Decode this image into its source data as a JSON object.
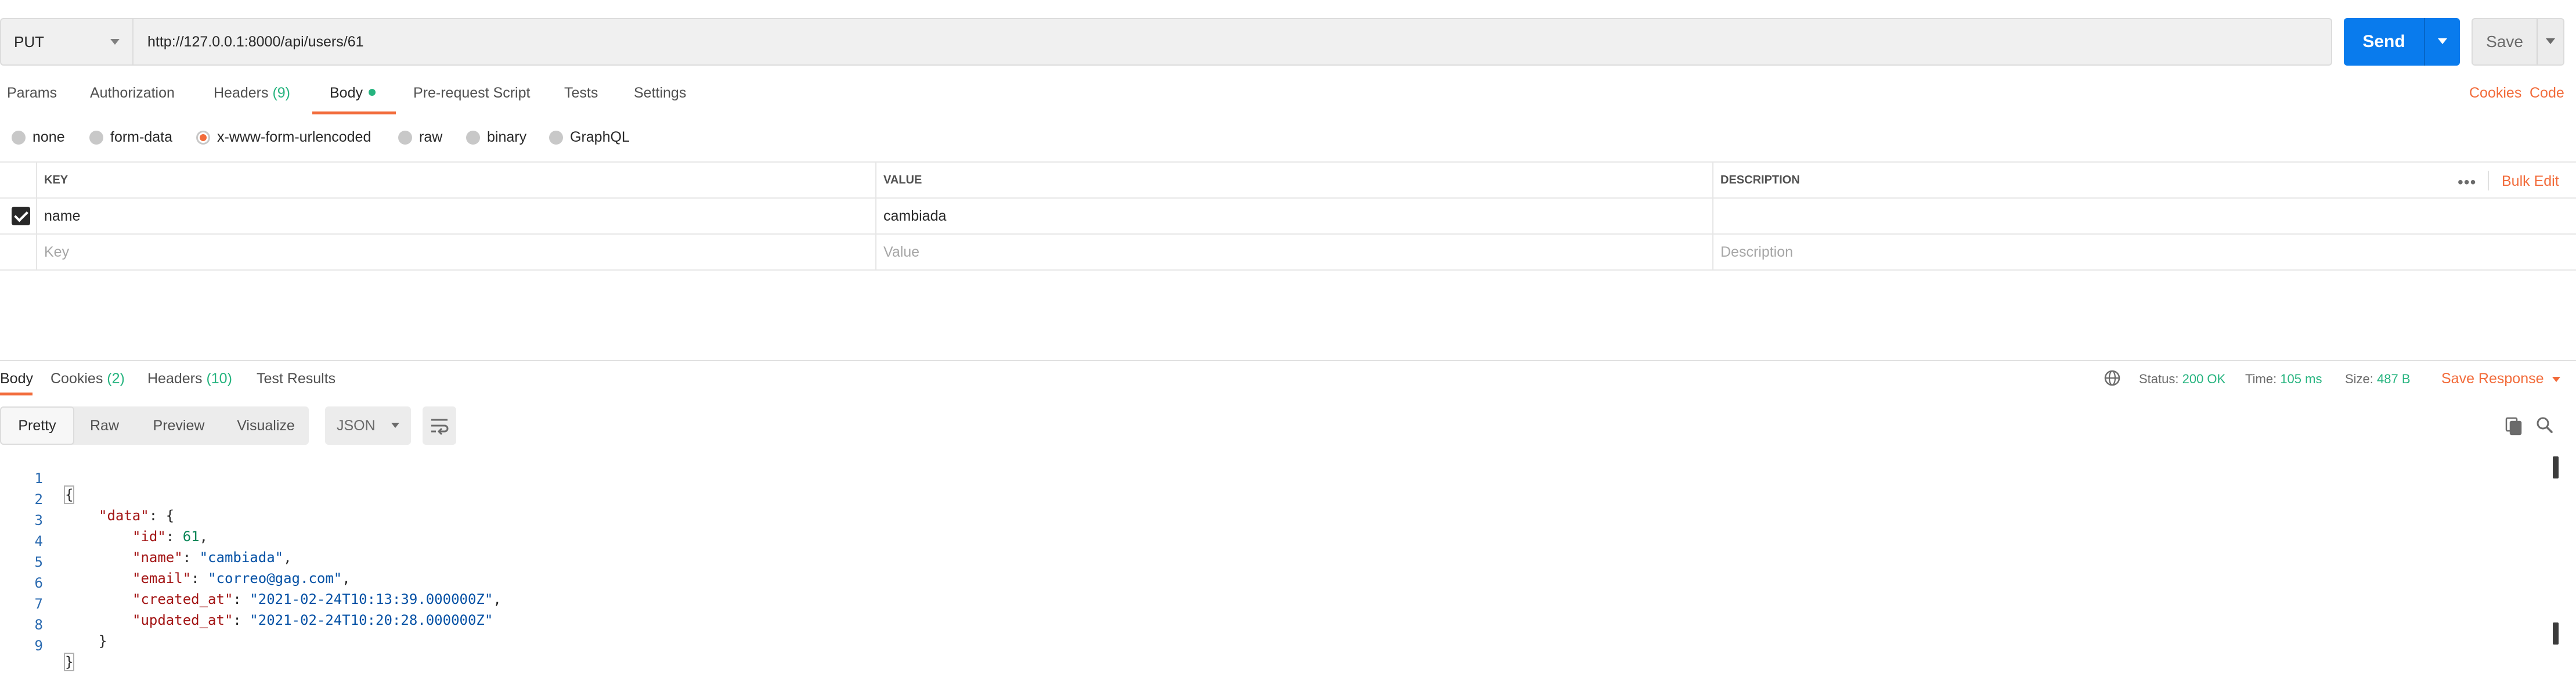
{
  "request": {
    "method": "PUT",
    "url": "http://127.0.0.1:8000/api/users/61",
    "send_label": "Send",
    "save_label": "Save"
  },
  "request_tabs": {
    "params": "Params",
    "authorization": "Authorization",
    "headers": "Headers",
    "headers_count": "(9)",
    "body": "Body",
    "pre_request": "Pre-request Script",
    "tests": "Tests",
    "settings": "Settings",
    "cookies_link": "Cookies",
    "code_link": "Code"
  },
  "body_types": {
    "none": "none",
    "form_data": "form-data",
    "urlencoded": "x-www-form-urlencoded",
    "raw": "raw",
    "binary": "binary",
    "graphql": "GraphQL",
    "selected": "x-www-form-urlencoded"
  },
  "params_table": {
    "headers": {
      "key": "KEY",
      "value": "VALUE",
      "description": "DESCRIPTION"
    },
    "more": "•••",
    "bulk_edit": "Bulk Edit",
    "rows": [
      {
        "checked": true,
        "key": "name",
        "value": "cambiada",
        "description": ""
      }
    ],
    "placeholders": {
      "key": "Key",
      "value": "Value",
      "description": "Description"
    }
  },
  "response_tabs": {
    "body": "Body",
    "cookies": "Cookies",
    "cookies_count": "(2)",
    "headers": "Headers",
    "headers_count": "(10)",
    "test_results": "Test Results"
  },
  "response_status": {
    "status_label": "Status:",
    "status_value": "200 OK",
    "time_label": "Time:",
    "time_value": "105 ms",
    "size_label": "Size:",
    "size_value": "487 B",
    "save_response": "Save Response"
  },
  "view_modes": {
    "pretty": "Pretty",
    "raw": "Raw",
    "preview": "Preview",
    "visualize": "Visualize",
    "format": "JSON"
  },
  "response_body": {
    "lines": [
      {
        "num": "1",
        "open": "{"
      },
      {
        "num": "2",
        "key": "\"data\"",
        "punct": ": {"
      },
      {
        "num": "3",
        "key": "\"id\"",
        "sep": ": ",
        "number": "61",
        "tail": ","
      },
      {
        "num": "4",
        "key": "\"name\"",
        "sep": ": ",
        "string": "\"cambiada\"",
        "tail": ","
      },
      {
        "num": "5",
        "key": "\"email\"",
        "sep": ": ",
        "string": "\"correo@gag.com\"",
        "tail": ","
      },
      {
        "num": "6",
        "key": "\"created_at\"",
        "sep": ": ",
        "string": "\"2021-02-24T10:13:39.000000Z\"",
        "tail": ","
      },
      {
        "num": "7",
        "key": "\"updated_at\"",
        "sep": ": ",
        "string": "\"2021-02-24T10:20:28.000000Z\""
      },
      {
        "num": "8",
        "close": "}"
      },
      {
        "num": "9",
        "close_root": "}"
      }
    ]
  },
  "colors": {
    "accent": "#f26b3a",
    "send": "#097bed",
    "success": "#26b47f"
  }
}
